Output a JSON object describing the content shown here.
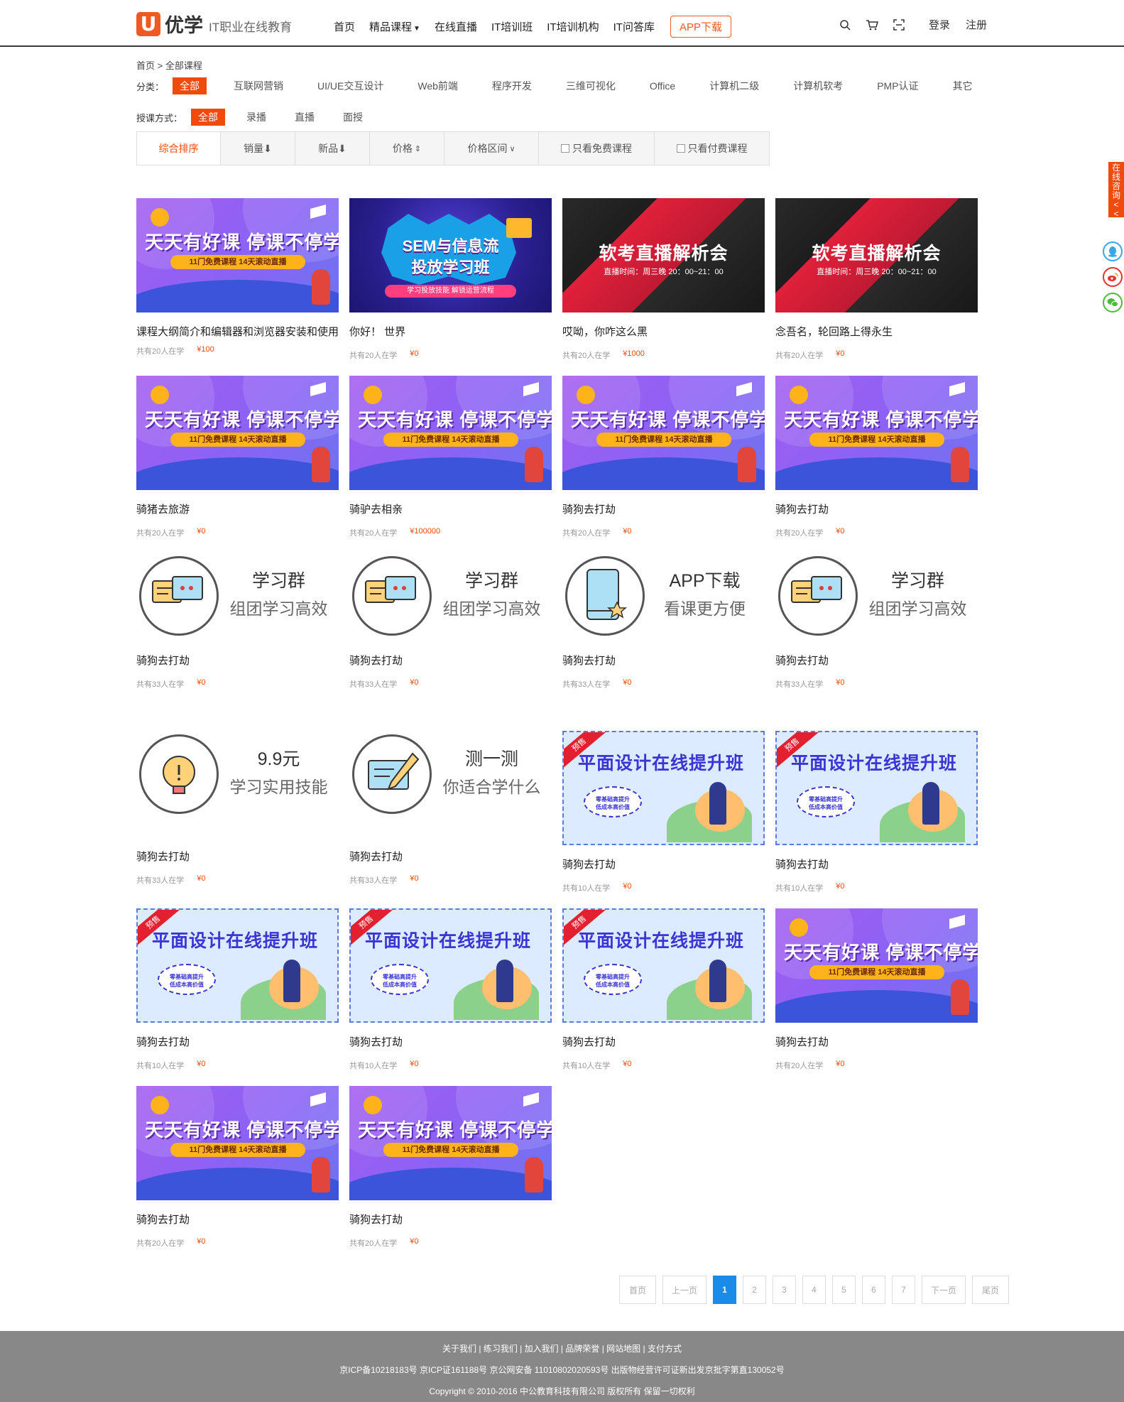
{
  "header": {
    "logo_mark": "U",
    "logo_name": "优学",
    "logo_slogan": "IT职业在线教育",
    "nav": [
      "首页",
      "精品课程",
      "在线直播",
      "IT培训班",
      "IT培训机构",
      "IT问答库"
    ],
    "app_button": "APP下载",
    "login": "登录",
    "register": "注册"
  },
  "breadcrumb": "首页 > 全部课程",
  "filters": {
    "category_label": "分类：",
    "categories": [
      "全部",
      "互联网营销",
      "UI/UE交互设计",
      "Web前端",
      "程序开发",
      "三维可视化",
      "Office",
      "计算机二级",
      "计算机软考",
      "PMP认证",
      "其它"
    ],
    "mode_label": "授课方式：",
    "modes": [
      "全部",
      "录播",
      "直播",
      "面授"
    ]
  },
  "sortbar": {
    "items": [
      "综合排序",
      "销量",
      "新品",
      "价格",
      "价格区间",
      "只看免费课程",
      "只看付费课程"
    ]
  },
  "thumbs": {
    "good_headline": "天天有好课 停课不停学",
    "good_pill": "11门免费课程 14天滚动直播",
    "sem_title1": "SEM与信息流",
    "sem_title2": "投放学习班",
    "sem_tag": "学习投放技能 解锁运营流程",
    "exam_title": "软考直播解析会",
    "exam_time": "直播时间：周三晚 20：00~21：00",
    "group_t1": "学习群",
    "group_t2": "组团学习高效",
    "app_t1": "APP下载",
    "app_t2": "看课更方便",
    "price_t1": "9.9元",
    "price_t2": "学习实用技能",
    "test_t1": "测一测",
    "test_t2": "你适合学什么",
    "design_ribbon": "预售",
    "design_headline": "平面设计在线提升班",
    "design_bubble1": "零基础高提升",
    "design_bubble2": "低成本高价值"
  },
  "courses": [
    {
      "title": "课程大纲简介和编辑器和浏览器安装和使用",
      "students": "共有20人在学",
      "price": "¥100",
      "thumb": "good"
    },
    {
      "title": "你好！ 世界",
      "students": "共有20人在学",
      "price": "¥0",
      "thumb": "sem"
    },
    {
      "title": "哎呦，你咋这么黑",
      "students": "共有20人在学",
      "price": "¥1000",
      "thumb": "exam"
    },
    {
      "title": "念吾名，轮回路上得永生",
      "students": "共有20人在学",
      "price": "¥0",
      "thumb": "exam"
    },
    {
      "title": "骑猪去旅游",
      "students": "共有20人在学",
      "price": "¥0",
      "thumb": "good"
    },
    {
      "title": "骑驴去相亲",
      "students": "共有20人在学",
      "price": "¥100000",
      "thumb": "good"
    },
    {
      "title": "骑狗去打劫",
      "students": "共有20人在学",
      "price": "¥0",
      "thumb": "good"
    },
    {
      "title": "骑狗去打劫",
      "students": "共有20人在学",
      "price": "¥0",
      "thumb": "good"
    },
    {
      "title": "骑狗去打劫",
      "students": "共有33人在学",
      "price": "¥0",
      "thumb": "group"
    },
    {
      "title": "骑狗去打劫",
      "students": "共有33人在学",
      "price": "¥0",
      "thumb": "group"
    },
    {
      "title": "骑狗去打劫",
      "students": "共有33人在学",
      "price": "¥0",
      "thumb": "app"
    },
    {
      "title": "骑狗去打劫",
      "students": "共有33人在学",
      "price": "¥0",
      "thumb": "group"
    },
    {
      "title": "骑狗去打劫",
      "students": "共有33人在学",
      "price": "¥0",
      "thumb": "price"
    },
    {
      "title": "骑狗去打劫",
      "students": "共有33人在学",
      "price": "¥0",
      "thumb": "test"
    },
    {
      "title": "骑狗去打劫",
      "students": "共有10人在学",
      "price": "¥0",
      "thumb": "design"
    },
    {
      "title": "骑狗去打劫",
      "students": "共有10人在学",
      "price": "¥0",
      "thumb": "design"
    },
    {
      "title": "骑狗去打劫",
      "students": "共有10人在学",
      "price": "¥0",
      "thumb": "design"
    },
    {
      "title": "骑狗去打劫",
      "students": "共有10人在学",
      "price": "¥0",
      "thumb": "design"
    },
    {
      "title": "骑狗去打劫",
      "students": "共有10人在学",
      "price": "¥0",
      "thumb": "design"
    },
    {
      "title": "骑狗去打劫",
      "students": "共有20人在学",
      "price": "¥0",
      "thumb": "good"
    },
    {
      "title": "骑狗去打劫",
      "students": "共有20人在学",
      "price": "¥0",
      "thumb": "good"
    },
    {
      "title": "骑狗去打劫",
      "students": "共有20人在学",
      "price": "¥0",
      "thumb": "good"
    }
  ],
  "pagination": {
    "first": "首页",
    "prev": "上一页",
    "pages": [
      "1",
      "2",
      "3",
      "4",
      "5",
      "6",
      "7"
    ],
    "current": "1",
    "next": "下一页",
    "last": "尾页"
  },
  "footer": {
    "links": "关于我们 | 练习我们 | 加入我们 | 品牌荣誉 | 网站地图 | 支付方式",
    "icp": "京ICP备10218183号 京ICP证161188号 京公网安备 11010802020593号 出版物经营许可证新出发京批字第直130052号",
    "copyright": "Copyright © 2010-2016 中公教育科技有限公司 版权所有 保留一切权利"
  },
  "side": {
    "consult": "在线咨询<<"
  },
  "colors": {
    "accent": "#f04b0c",
    "pager_current": "#1a8be8",
    "footer_bg": "#888888"
  }
}
